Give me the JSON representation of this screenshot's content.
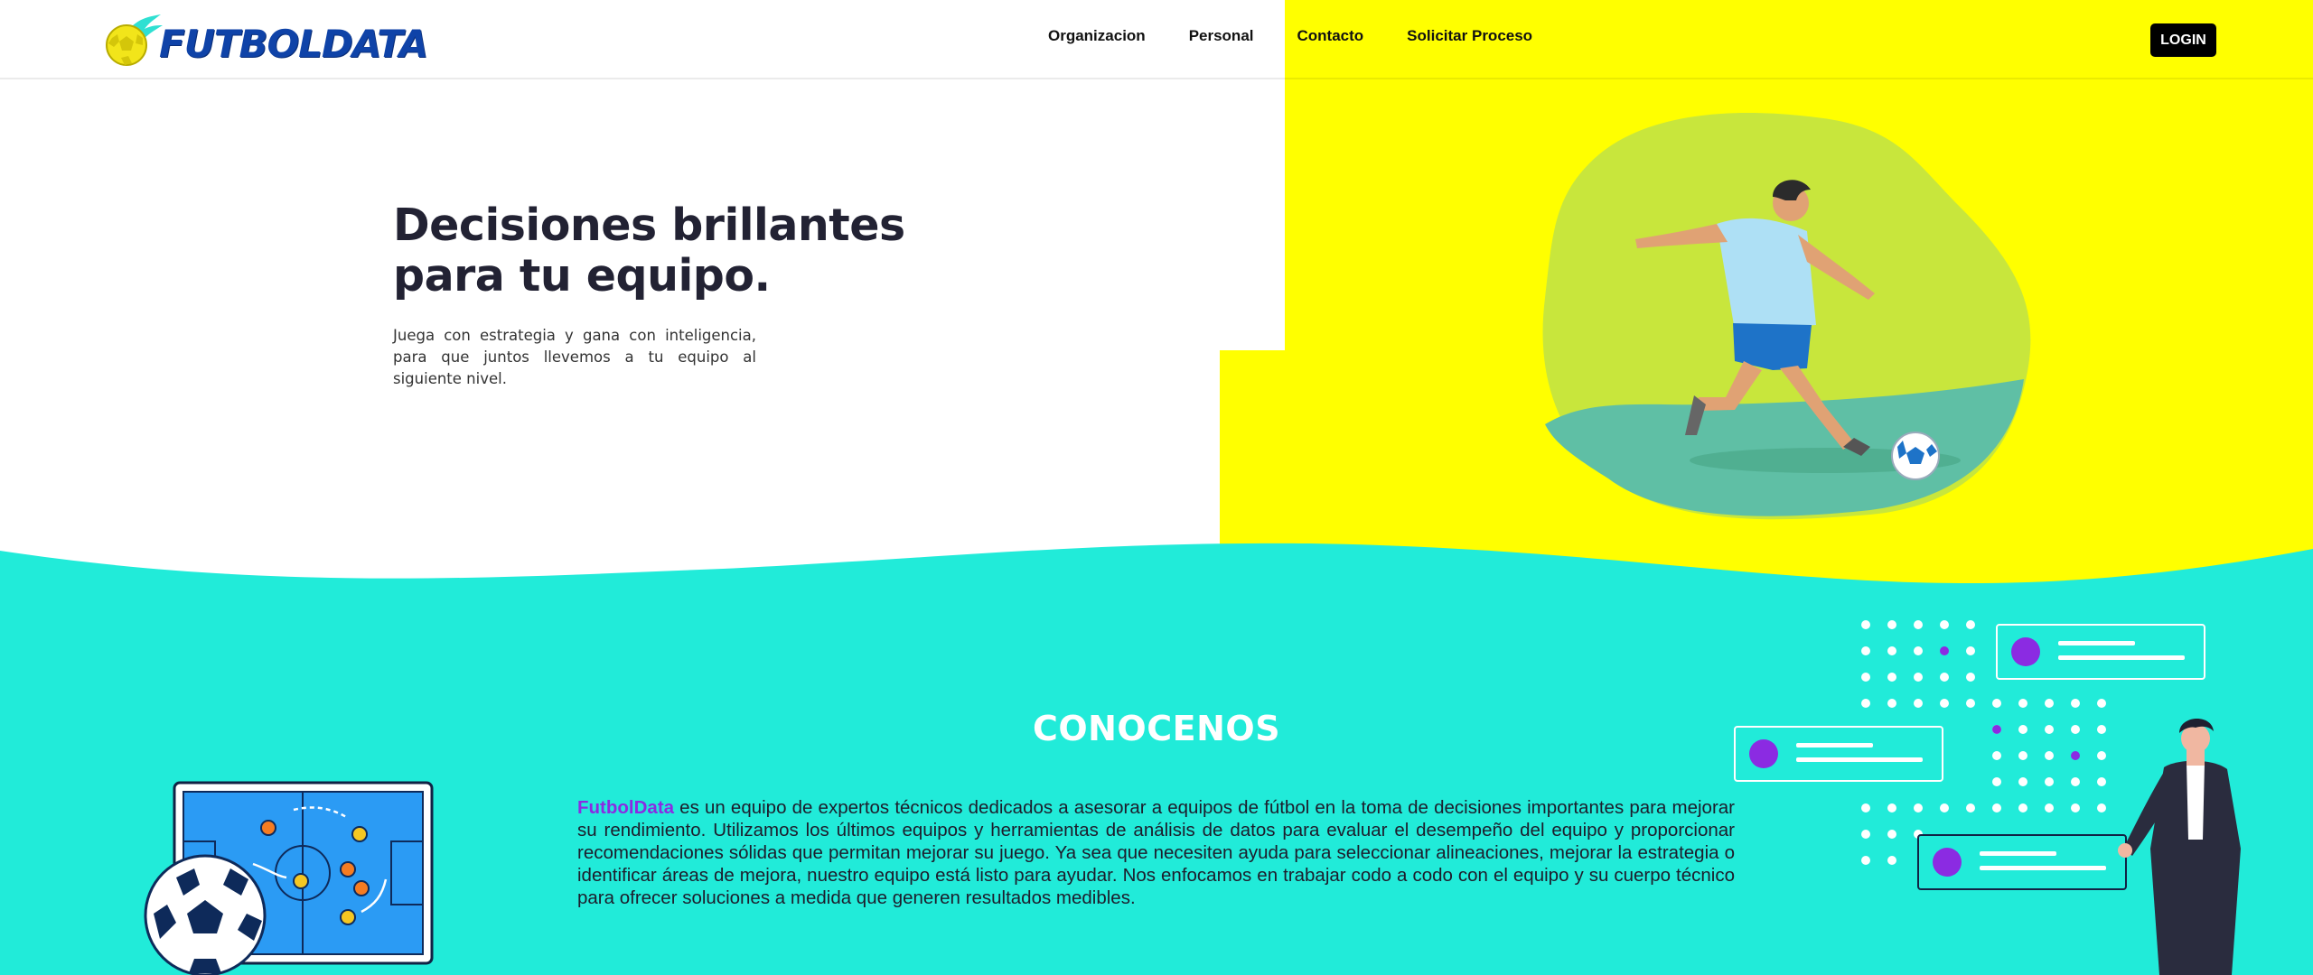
{
  "header": {
    "logo_text": "FUTBOLDATA",
    "nav": [
      "Organizacion",
      "Personal",
      "Contacto",
      "Solicitar Proceso"
    ],
    "login_label": "LOGIN"
  },
  "hero": {
    "title_line1": "Decisiones brillantes",
    "title_line2": "para tu equipo.",
    "subtitle": "Juega con estrategia y gana con inteligencia, para que juntos llevemos a tu equipo al siguiente nivel."
  },
  "about": {
    "title": "CONOCENOS",
    "brand": "FutbolData",
    "text": " es un equipo de expertos técnicos dedicados a asesorar a equipos de fútbol en la toma de decisiones importantes para mejorar su rendimiento. Utilizamos los últimos equipos y herramientas de análisis de datos para evaluar el desempeño del equipo y proporcionar recomendaciones sólidas que permitan mejorar su juego. Ya sea que necesiten ayuda para seleccionar alineaciones, mejorar la estrategia o identificar áreas de mejora, nuestro equipo está listo para ayudar. Nos enfocamos en trabajar codo a codo con el equipo y su cuerpo técnico para ofrecer soluciones a medida que generen resultados medibles."
  },
  "colors": {
    "yellow": "#ffff00",
    "teal": "#21ebd9",
    "brand_blue": "#0f43a8",
    "accent_purple": "#8b2be2",
    "blob_green": "#c8e63c"
  },
  "icons": {
    "logo": "soccer-ball-logo-icon",
    "hero": "soccer-player-illustration",
    "tactics": "tactics-board-illustration",
    "dashboard": "dashboard-cards-illustration",
    "presenter": "businessman-illustration"
  }
}
